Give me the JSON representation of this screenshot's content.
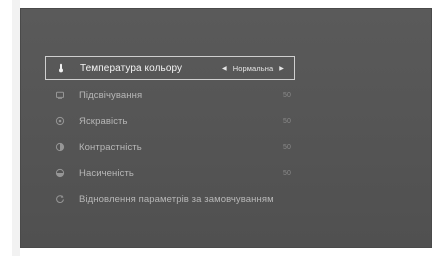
{
  "menu": {
    "items": [
      {
        "label": "Температура кольору",
        "icon": "thermometer-icon",
        "selector_value": "Нормальна",
        "selected": true
      },
      {
        "label": "Підсвічування",
        "icon": "backlight-icon",
        "value": "50"
      },
      {
        "label": "Яскравість",
        "icon": "brightness-icon",
        "value": "50"
      },
      {
        "label": "Контрастність",
        "icon": "contrast-icon",
        "value": "50"
      },
      {
        "label": "Насиченість",
        "icon": "saturation-icon",
        "value": "50"
      },
      {
        "label": "Відновлення параметрів за замовчуванням",
        "icon": "reset-icon"
      }
    ],
    "left_arrow": "◀",
    "right_arrow": "▶"
  },
  "colors": {
    "screen_background": "#555555",
    "selected_border": "#cfcfcf",
    "text_selected": "#f4f4f4",
    "text_normal": "#bdbdbd"
  }
}
